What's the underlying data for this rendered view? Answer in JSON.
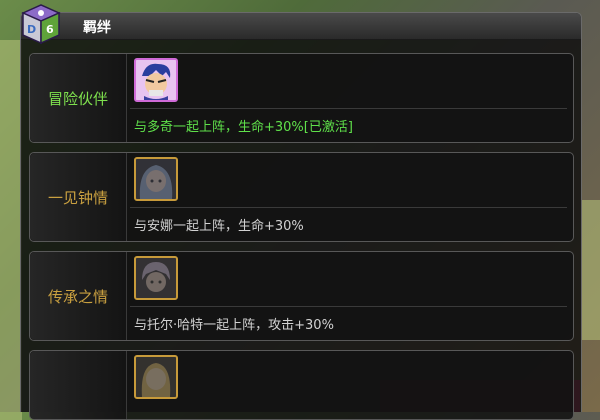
{
  "window": {
    "title": "羁绊"
  },
  "colors": {
    "active": "#5fe04a",
    "inactive_label": "#c9a040",
    "desc": "#d2d2d2"
  },
  "bonds": [
    {
      "label": "冒险伙伴",
      "desc": "与多奇一起上阵，生命+30%[已激活]",
      "active": true,
      "icon": "hero-portrait-icon"
    },
    {
      "label": "一见钟情",
      "desc": "与安娜一起上阵，生命+30%",
      "active": false,
      "icon": "anna-portrait-icon"
    },
    {
      "label": "传承之情",
      "desc": "与托尔·哈特一起上阵，攻击+30%",
      "active": false,
      "icon": "thor-portrait-icon"
    },
    {
      "label": "",
      "desc": "",
      "active": false,
      "icon": "locked-portrait-icon"
    }
  ]
}
